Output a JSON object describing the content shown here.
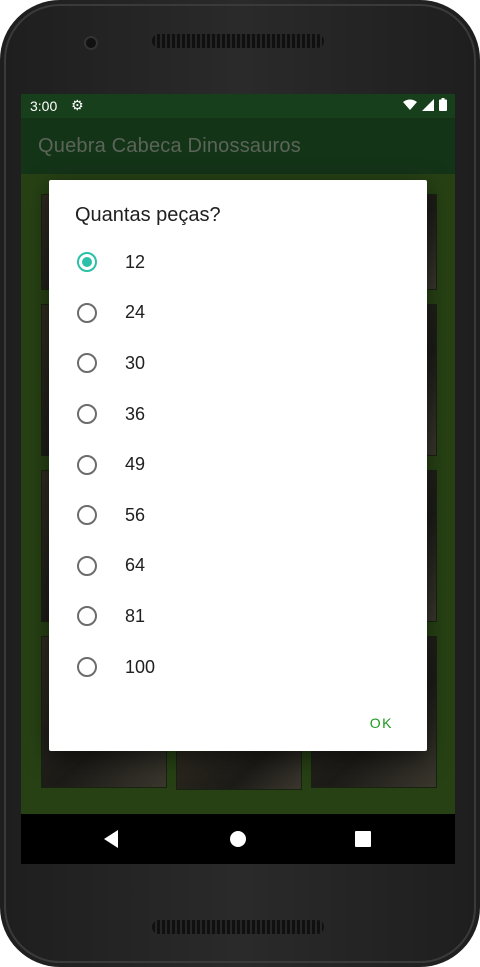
{
  "status_bar": {
    "time": "3:00"
  },
  "app_bar": {
    "title": "Quebra Cabeca Dinossauros"
  },
  "dialog": {
    "title": "Quantas peças?",
    "options": [
      {
        "label": "12",
        "selected": true
      },
      {
        "label": "24",
        "selected": false
      },
      {
        "label": "30",
        "selected": false
      },
      {
        "label": "36",
        "selected": false
      },
      {
        "label": "49",
        "selected": false
      },
      {
        "label": "56",
        "selected": false
      },
      {
        "label": "64",
        "selected": false
      },
      {
        "label": "81",
        "selected": false
      },
      {
        "label": "100",
        "selected": false
      }
    ],
    "ok_label": "OK"
  },
  "nav_bar": {
    "back_icon": "back-triangle-icon",
    "home_icon": "home-circle-icon",
    "recents_icon": "recents-square-icon"
  },
  "colors": {
    "status_bar": "#173f1b",
    "app_bar": "#1f5126",
    "accent": "#2bc0a8",
    "ok": "#1e9a1e"
  }
}
